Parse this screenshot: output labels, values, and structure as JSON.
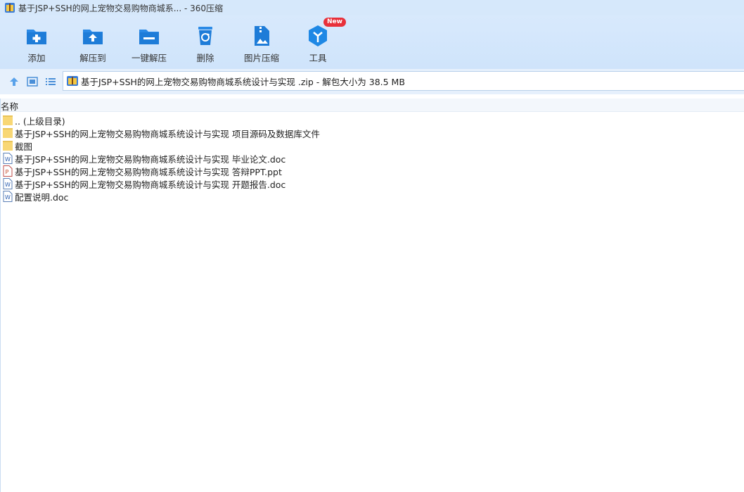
{
  "window": {
    "title": "基于JSP+SSH的网上宠物交易购物商城系... - 360压缩",
    "app_icon": "zip-archive-icon"
  },
  "toolbar": {
    "items": [
      {
        "label": "添加",
        "icon": "add-folder-icon"
      },
      {
        "label": "解压到",
        "icon": "extract-to-icon"
      },
      {
        "label": "一键解压",
        "icon": "one-click-extract-icon"
      },
      {
        "label": "删除",
        "icon": "recycle-bin-icon"
      },
      {
        "label": "图片压缩",
        "icon": "image-compress-icon"
      },
      {
        "label": "工具",
        "icon": "tools-cube-icon",
        "badge": "New"
      }
    ]
  },
  "address": {
    "text": "基于JSP+SSH的网上宠物交易购物商城系统设计与实现 .zip - 解包大小为 38.5 MB"
  },
  "columns": {
    "name": "名称"
  },
  "files": [
    {
      "name": ".. (上级目录)",
      "type": "folder"
    },
    {
      "name": "基于JSP+SSH的网上宠物交易购物商城系统设计与实现 项目源码及数据库文件",
      "type": "folder"
    },
    {
      "name": "截图",
      "type": "folder"
    },
    {
      "name": "基于JSP+SSH的网上宠物交易购物商城系统设计与实现 毕业论文.doc",
      "type": "doc"
    },
    {
      "name": "基于JSP+SSH的网上宠物交易购物商城系统设计与实现 答辩PPT.ppt",
      "type": "ppt"
    },
    {
      "name": "基于JSP+SSH的网上宠物交易购物商城系统设计与实现 开题报告.doc",
      "type": "doc"
    },
    {
      "name": "配置说明.doc",
      "type": "doc"
    }
  ],
  "colors": {
    "accent": "#1e88e5",
    "toolbar_bg": "#d6e8fb",
    "folder": "#f8d775",
    "badge": "#e8303a"
  }
}
